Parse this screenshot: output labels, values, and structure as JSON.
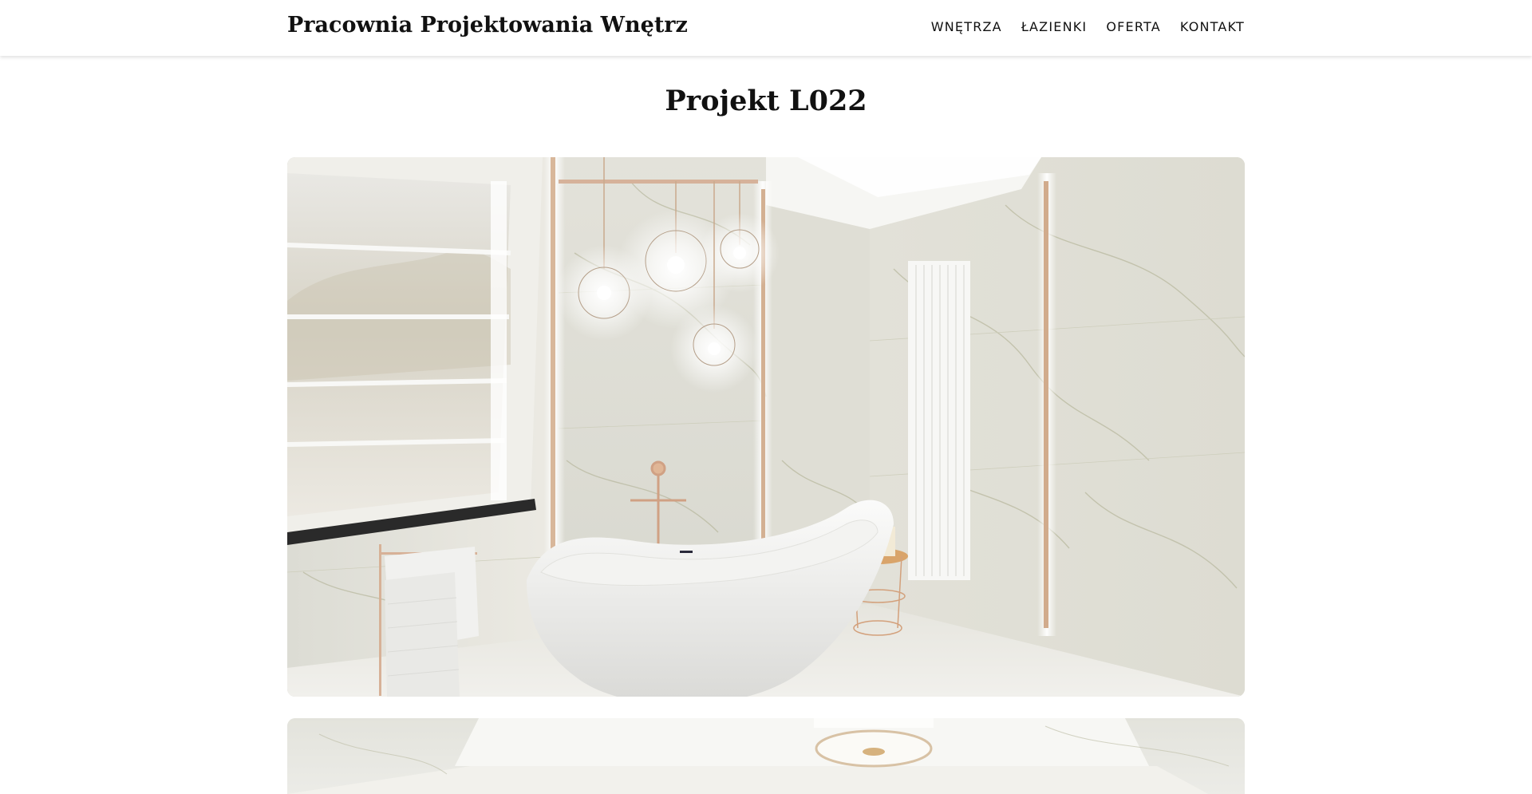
{
  "header": {
    "brand": "Pracownia Projektowania Wnętrz",
    "nav": [
      "WNĘTRZA",
      "ŁAZIENKI",
      "OFERTA",
      "KONTAKT"
    ]
  },
  "page": {
    "title": "Projekt L022"
  },
  "gallery": [
    {
      "subject": "bathroom-with-freestanding-bathtub"
    },
    {
      "subject": "bathroom-ceiling-lamp"
    }
  ]
}
